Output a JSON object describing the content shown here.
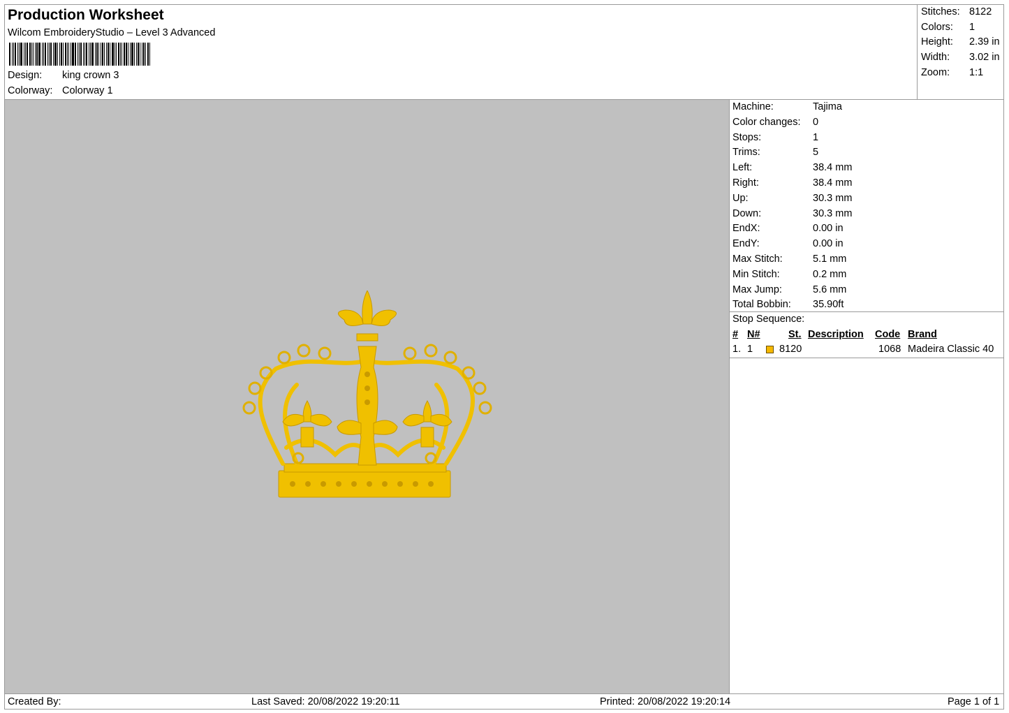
{
  "header": {
    "title": "Production Worksheet",
    "subtitle": "Wilcom EmbroideryStudio – Level 3 Advanced",
    "design_label": "Design:",
    "design_value": "king crown 3",
    "colorway_label": "Colorway:",
    "colorway_value": "Colorway 1"
  },
  "summary": {
    "stitches_label": "Stitches:",
    "stitches_value": "8122",
    "colors_label": "Colors:",
    "colors_value": "1",
    "height_label": "Height:",
    "height_value": "2.39 in",
    "width_label": "Width:",
    "width_value": "3.02 in",
    "zoom_label": "Zoom:",
    "zoom_value": "1:1"
  },
  "machine_info": [
    {
      "label": "Machine:",
      "value": "Tajima"
    },
    {
      "label": "Color changes:",
      "value": "0"
    },
    {
      "label": "Stops:",
      "value": "1"
    },
    {
      "label": "Trims:",
      "value": "5"
    },
    {
      "label": "Left:",
      "value": "38.4 mm"
    },
    {
      "label": "Right:",
      "value": "38.4 mm"
    },
    {
      "label": "Up:",
      "value": "30.3 mm"
    },
    {
      "label": "Down:",
      "value": "30.3 mm"
    },
    {
      "label": "EndX:",
      "value": "0.00 in"
    },
    {
      "label": "EndY:",
      "value": "0.00 in"
    },
    {
      "label": "Max Stitch:",
      "value": "5.1 mm"
    },
    {
      "label": "Min Stitch:",
      "value": "0.2 mm"
    },
    {
      "label": "Max Jump:",
      "value": "5.6 mm"
    },
    {
      "label": "Total Bobbin:",
      "value": "35.90ft"
    }
  ],
  "stop_sequence": {
    "title": "Stop Sequence:",
    "columns": [
      "#",
      "N#",
      "St.",
      "Description",
      "Code",
      "Brand"
    ],
    "rows": [
      {
        "num": "1.",
        "n": "1",
        "color": "#f5b800",
        "st": "8120",
        "description": "",
        "code": "1068",
        "brand": "Madeira Classic 40"
      }
    ]
  },
  "preview": {
    "background": "#c0c0c0",
    "thread_color": "#f0c000"
  },
  "footer": {
    "created_by": "Created By:",
    "last_saved": "Last Saved: 20/08/2022 19:20:11",
    "printed": "Printed: 20/08/2022 19:20:14",
    "page": "Page 1 of 1"
  }
}
